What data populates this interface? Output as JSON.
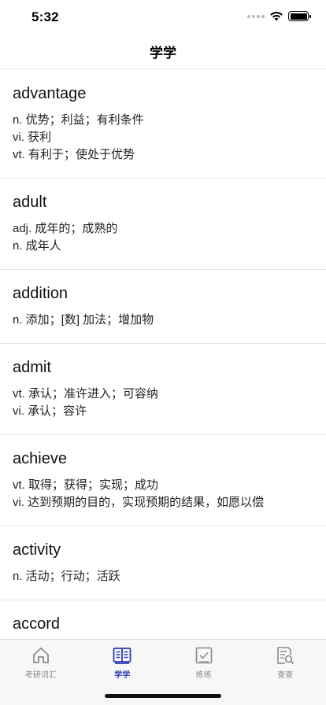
{
  "status": {
    "time": "5:32",
    "icons": [
      "signal-icon",
      "wifi-icon",
      "battery-icon"
    ]
  },
  "nav": {
    "title": "学学"
  },
  "words": [
    {
      "word": "advantage",
      "defs": [
        "n. 优势；利益；有利条件",
        "vi. 获利",
        "vt. 有利于；使处于优势"
      ]
    },
    {
      "word": "adult",
      "defs": [
        "adj. 成年的；成熟的",
        "n. 成年人"
      ]
    },
    {
      "word": "addition",
      "defs": [
        "n. 添加；[数] 加法；增加物"
      ]
    },
    {
      "word": "admit",
      "defs": [
        "vt. 承认；准许进入；可容纳",
        "vi. 承认；容许"
      ]
    },
    {
      "word": "achieve",
      "defs": [
        "vt. 取得；获得；实现；成功",
        "vi. 达到预期的目的，实现预期的结果，如愿以偿"
      ]
    },
    {
      "word": "activity",
      "defs": [
        "n. 活动；行动；活跃"
      ]
    },
    {
      "word": "accord",
      "defs": []
    }
  ],
  "tabs": [
    {
      "label": "考研词汇",
      "icon": "home-icon",
      "active": false
    },
    {
      "label": "学学",
      "icon": "book-icon",
      "active": true
    },
    {
      "label": "练练",
      "icon": "checkbox-icon",
      "active": false
    },
    {
      "label": "查查",
      "icon": "search-document-icon",
      "active": false
    }
  ],
  "colors": {
    "accent": "#2b3bb5",
    "inactive": "#8a8a8a",
    "divider": "#e6e6e6",
    "tab_bar_bg": "#f7f7f7"
  }
}
